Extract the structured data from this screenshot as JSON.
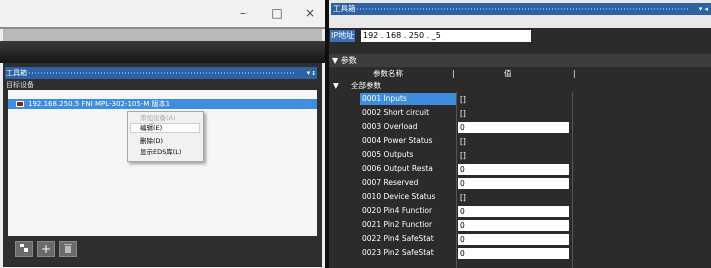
{
  "left_window": {
    "controls": {
      "minimize": "–",
      "maximize": "□",
      "close": "×"
    },
    "toolbox": {
      "title": "工具箱",
      "pin_glyph": "▾ ᵻ",
      "target_devices_label": "目标设备",
      "device": "192.168.250.5   FNI MPL-302-105-M   版本1",
      "context_menu": {
        "items": [
          "添加设备(A)",
          "编辑(E)",
          "删除(D)",
          "显示EDS库(L)"
        ]
      },
      "bottom_buttons": [
        "device-icon",
        "plus-icon",
        "trash-icon"
      ]
    }
  },
  "right_window": {
    "title": "工具箱",
    "ip_label": "IP地址",
    "ip_value": "192 . 168 . 250 . _5",
    "params_section": "▼ 参数",
    "columns": {
      "name": "参数名称",
      "value": "值",
      "sep": "|"
    },
    "all_params": {
      "arrow": "▼",
      "label": "全部参数"
    },
    "rows": [
      {
        "name": "0001 Inputs",
        "value": "[]",
        "editable": false
      },
      {
        "name": "0002 Short circuit",
        "value": "[]",
        "editable": false
      },
      {
        "name": "0003 Overload",
        "value": "0",
        "editable": true
      },
      {
        "name": "0004 Power Status",
        "value": "[]",
        "editable": false
      },
      {
        "name": "0005 Outputs",
        "value": "[]",
        "editable": false
      },
      {
        "name": "0006 Output Resta",
        "value": "0",
        "editable": true
      },
      {
        "name": "0007 Reserved",
        "value": "0",
        "editable": true
      },
      {
        "name": "0010 Device Status",
        "value": "[]",
        "editable": false
      },
      {
        "name": "0020 Pin4 Functior",
        "value": "0",
        "editable": true
      },
      {
        "name": "0021 Pin2 Functior",
        "value": "0",
        "editable": true
      },
      {
        "name": "0022 Pin4 SafeStat",
        "value": "0",
        "editable": true
      },
      {
        "name": "0023 Pin2 SafeStat",
        "value": "0",
        "editable": true
      }
    ]
  },
  "colors": {
    "accent_blue": "#3d8ee0",
    "title_blue": "#2d63a4",
    "dark_bg": "#2b2b2b"
  }
}
